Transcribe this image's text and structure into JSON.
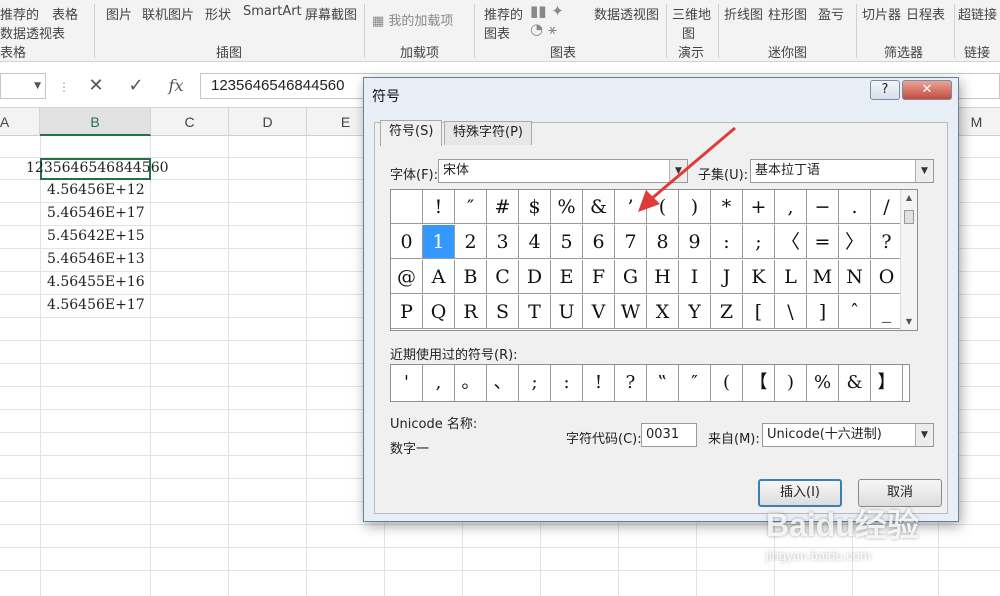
{
  "ribbon": {
    "items": [
      {
        "id": "pivot",
        "text1": "推荐的",
        "text2": "数据透视表"
      },
      {
        "id": "table",
        "text1": "表格"
      },
      {
        "id": "picture",
        "text1": "图片"
      },
      {
        "id": "online_picture",
        "text1": "联机图片"
      },
      {
        "id": "shapes",
        "text1": "形状"
      },
      {
        "id": "smartart",
        "text1": "SmartArt"
      },
      {
        "id": "screenshot",
        "text1": "屏幕截图"
      },
      {
        "id": "my_addins",
        "text1": "我的加载项"
      },
      {
        "id": "rec_charts",
        "text1": "推荐的",
        "text2": "图表"
      },
      {
        "id": "pivot_chart",
        "text1": "数据透视图"
      },
      {
        "id": "map3d",
        "text1": "三维地",
        "text2": "图"
      },
      {
        "id": "line",
        "text1": "折线图"
      },
      {
        "id": "column",
        "text1": "柱形图"
      },
      {
        "id": "winloss",
        "text1": "盈亏"
      },
      {
        "id": "slicer",
        "text1": "切片器"
      },
      {
        "id": "timeline",
        "text1": "日程表"
      },
      {
        "id": "hyperlink",
        "text1": "超链接"
      }
    ],
    "groups": [
      "表格",
      "插图",
      "加载项",
      "图表",
      "演示",
      "迷你图",
      "筛选器",
      "链接"
    ]
  },
  "formula_bar": {
    "cancel": "✕",
    "enter": "✓",
    "fx": "fx",
    "value": "1235646546844560"
  },
  "columns": [
    "A",
    "B",
    "C",
    "D",
    "E",
    "M"
  ],
  "cells": [
    "1235646546844560",
    "4.56456E+12",
    "5.46546E+17",
    "5.45642E+15",
    "5.46546E+13",
    "4.56455E+16",
    "4.56456E+17"
  ],
  "dialog": {
    "title": "符号",
    "help": "?",
    "close": "✕",
    "tabs": [
      "符号(S)",
      "特殊字符(P)"
    ],
    "font_label": "字体(F):",
    "font_value": "宋体",
    "subset_label": "子集(U):",
    "subset_value": "基本拉丁语",
    "symbols": [
      [
        "",
        "!",
        "″",
        "#",
        "$",
        "%",
        "&",
        "’",
        "(",
        ")",
        "*",
        "+",
        ",",
        "−",
        ".",
        "/"
      ],
      [
        "0",
        "1",
        "2",
        "3",
        "4",
        "5",
        "6",
        "7",
        "8",
        "9",
        ":",
        ";",
        "〈",
        "=",
        "〉",
        "?"
      ],
      [
        "@",
        "A",
        "B",
        "C",
        "D",
        "E",
        "F",
        "G",
        "H",
        "I",
        "J",
        "K",
        "L",
        "M",
        "N",
        "O"
      ],
      [
        "P",
        "Q",
        "R",
        "S",
        "T",
        "U",
        "V",
        "W",
        "X",
        "Y",
        "Z",
        "[",
        "\\",
        "]",
        "ˆ",
        "_"
      ]
    ],
    "selected": "1",
    "recent_label": "近期使用过的符号(R):",
    "recent": [
      "'",
      ",",
      "。",
      "、",
      ";",
      ":",
      "!",
      "?",
      "‟",
      "″",
      "(",
      "【",
      ")",
      "%",
      "&",
      "】"
    ],
    "unicode_name_label": "Unicode 名称:",
    "unicode_name_value": "数字一",
    "char_code_label": "字符代码(C):",
    "char_code_value": "0031",
    "from_label": "来自(M):",
    "from_value": "Unicode(十六进制)",
    "insert": "插入(I)",
    "cancel": "取消"
  },
  "watermark": {
    "brand": "Baidu经验",
    "url": "jingyan.baidu.com"
  },
  "colors": {
    "accent": "#217346",
    "selection": "#3399ff",
    "arrow": "#e03a3a"
  }
}
